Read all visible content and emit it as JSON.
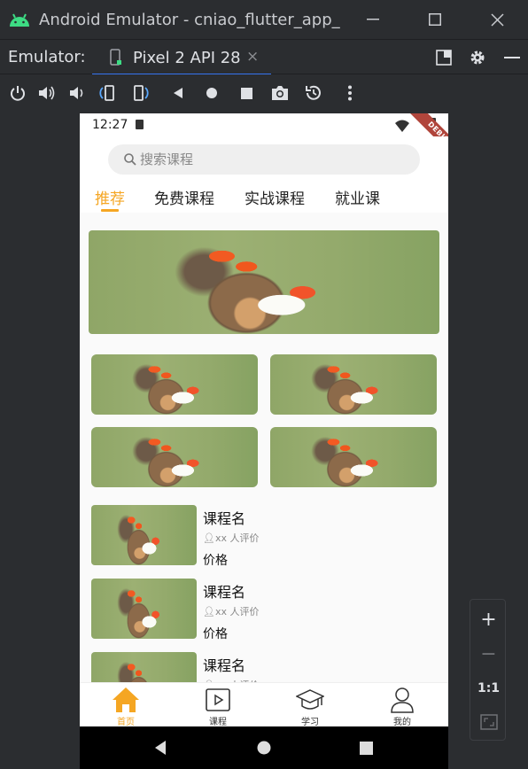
{
  "window": {
    "title": "Android Emulator - cniao_flutter_app_r",
    "minimize_icon": "minimize-icon",
    "maximize_icon": "maximize-icon",
    "close_icon": "close-icon"
  },
  "tabbar": {
    "label": "Emulator:",
    "device_tab": "Pixel 2 API 28",
    "close_glyph": "×"
  },
  "toolbar": {
    "icons": [
      "power-icon",
      "volume-up-icon",
      "volume-down-icon",
      "rotate-left-icon",
      "rotate-right-icon",
      "back-icon",
      "home-icon",
      "overview-icon",
      "screenshot-icon",
      "snapshot-icon",
      "more-icon"
    ]
  },
  "phone": {
    "status": {
      "time": "12:27",
      "debug_label": "DEBUG"
    },
    "search": {
      "placeholder": "搜索课程"
    },
    "categories": [
      {
        "label": "推荐",
        "active": true
      },
      {
        "label": "免费课程",
        "active": false
      },
      {
        "label": "实战课程",
        "active": false
      },
      {
        "label": "就业课",
        "active": false
      }
    ],
    "courses": [
      {
        "name": "课程名",
        "rating": "xx 人评价",
        "price": "价格"
      },
      {
        "name": "课程名",
        "rating": "xx 人评价",
        "price": "价格"
      },
      {
        "name": "课程名",
        "rating": "xx 人评价",
        "price": "价格"
      }
    ],
    "bottom_nav": [
      {
        "label": "首页",
        "icon": "home-icon",
        "active": true
      },
      {
        "label": "课程",
        "icon": "video-course-icon",
        "active": false
      },
      {
        "label": "学习",
        "icon": "graduation-cap-icon",
        "active": false
      },
      {
        "label": "我的",
        "icon": "user-icon",
        "active": false
      }
    ],
    "colors": {
      "accent": "#f5a623",
      "background": "#fafafa"
    }
  },
  "zoom": {
    "zoom_in": "+",
    "zoom_out": "−",
    "one_to_one": "1:1"
  }
}
